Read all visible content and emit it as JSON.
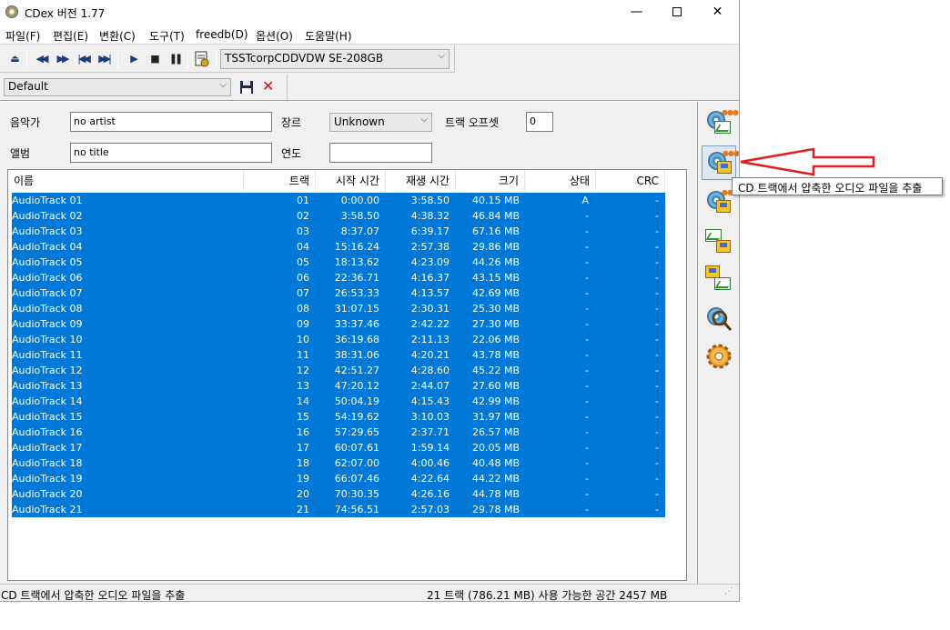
{
  "window": {
    "title": "CDex 버전 1.77",
    "min": "—",
    "close": "✕"
  },
  "menu": [
    "파일(F)",
    "편집(E)",
    "변환(C)",
    "도구(T)",
    "freedb(D)",
    "옵션(O)",
    "도움말(H)"
  ],
  "toolbar": {
    "drive": "TSSTcorpCDDVDW SE-208GB",
    "icons": [
      "eject-icon",
      "prev-track-icon",
      "next-track-icon",
      "skip-back-icon",
      "skip-forward-icon",
      "play-icon",
      "stop-icon",
      "pause-icon",
      "cd-info-icon"
    ]
  },
  "profile": {
    "value": "Default"
  },
  "fields": {
    "artist_label": "음악가",
    "artist_value": "no artist",
    "album_label": "앨범",
    "album_value": "no title",
    "genre_label": "장르",
    "genre_value": "Unknown",
    "year_label": "연도",
    "year_value": "",
    "offset_label": "트랙 오프셋",
    "offset_value": "0"
  },
  "table": {
    "headers": [
      "이름",
      "트랙",
      "시작 시간",
      "재생 시간",
      "크기",
      "상태",
      "CRC"
    ],
    "rows": [
      [
        "AudioTrack 01",
        "01",
        "0:00.00",
        "3:58.50",
        "40.15 MB",
        "A",
        "-"
      ],
      [
        "AudioTrack 02",
        "02",
        "3:58.50",
        "4:38.32",
        "46.84 MB",
        "-",
        "-"
      ],
      [
        "AudioTrack 03",
        "03",
        "8:37.07",
        "6:39.17",
        "67.16 MB",
        "-",
        "-"
      ],
      [
        "AudioTrack 04",
        "04",
        "15:16.24",
        "2:57.38",
        "29.86 MB",
        "-",
        "-"
      ],
      [
        "AudioTrack 05",
        "05",
        "18:13.62",
        "4:23.09",
        "44.26 MB",
        "-",
        "-"
      ],
      [
        "AudioTrack 06",
        "06",
        "22:36.71",
        "4:16.37",
        "43.15 MB",
        "-",
        "-"
      ],
      [
        "AudioTrack 07",
        "07",
        "26:53.33",
        "4:13.57",
        "42.69 MB",
        "-",
        "-"
      ],
      [
        "AudioTrack 08",
        "08",
        "31:07.15",
        "2:30.31",
        "25.30 MB",
        "-",
        "-"
      ],
      [
        "AudioTrack 09",
        "09",
        "33:37.46",
        "2:42.22",
        "27.30 MB",
        "-",
        "-"
      ],
      [
        "AudioTrack 10",
        "10",
        "36:19.68",
        "2:11.13",
        "22.06 MB",
        "-",
        "-"
      ],
      [
        "AudioTrack 11",
        "11",
        "38:31.06",
        "4:20.21",
        "43.78 MB",
        "-",
        "-"
      ],
      [
        "AudioTrack 12",
        "12",
        "42:51.27",
        "4:28.60",
        "45.22 MB",
        "-",
        "-"
      ],
      [
        "AudioTrack 13",
        "13",
        "47:20.12",
        "2:44.07",
        "27.60 MB",
        "-",
        "-"
      ],
      [
        "AudioTrack 14",
        "14",
        "50:04.19",
        "4:15.43",
        "42.99 MB",
        "-",
        "-"
      ],
      [
        "AudioTrack 15",
        "15",
        "54:19.62",
        "3:10.03",
        "31.97 MB",
        "-",
        "-"
      ],
      [
        "AudioTrack 16",
        "16",
        "57:29.65",
        "2:37.71",
        "26.57 MB",
        "-",
        "-"
      ],
      [
        "AudioTrack 17",
        "17",
        "60:07.61",
        "1:59.14",
        "20.05 MB",
        "-",
        "-"
      ],
      [
        "AudioTrack 18",
        "18",
        "62:07.00",
        "4:00.46",
        "40.48 MB",
        "-",
        "-"
      ],
      [
        "AudioTrack 19",
        "19",
        "66:07.46",
        "4:22.64",
        "44.22 MB",
        "-",
        "-"
      ],
      [
        "AudioTrack 20",
        "20",
        "70:30.35",
        "4:26.16",
        "44.78 MB",
        "-",
        "-"
      ],
      [
        "AudioTrack 21",
        "21",
        "74:56.51",
        "2:57.03",
        "29.78 MB",
        "-",
        "-"
      ]
    ]
  },
  "side_buttons": [
    "cd-to-wav-icon",
    "cd-to-compressed-icon",
    "cd-to-compressed-alt-icon",
    "wav-to-compressed-icon",
    "compressed-to-wav-icon",
    "cd-search-icon",
    "settings-gear-icon"
  ],
  "tooltip": "CD 트랙에서 압축한 오디오 파일을 추출",
  "status": {
    "left": "CD 트랙에서 압축한 오디오 파일을 추출",
    "right": "21 트랙 (786.21 MB) 사용 가능한 공간  2457 MB"
  },
  "colors": {
    "selection": "#0078d7",
    "annotation_arrow": "#e02020"
  }
}
